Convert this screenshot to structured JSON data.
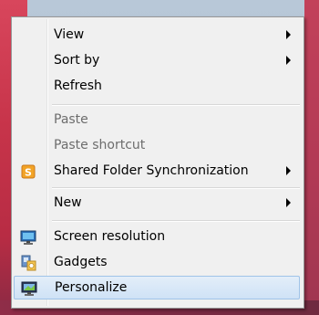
{
  "context_menu": {
    "items": [
      {
        "label": "View",
        "submenu": true,
        "enabled": true
      },
      {
        "label": "Sort by",
        "submenu": true,
        "enabled": true
      },
      {
        "label": "Refresh",
        "submenu": false,
        "enabled": true
      },
      {
        "label": "Paste",
        "submenu": false,
        "enabled": false
      },
      {
        "label": "Paste shortcut",
        "submenu": false,
        "enabled": false
      },
      {
        "label": "Shared Folder Synchronization",
        "submenu": true,
        "enabled": true,
        "icon": "shared-folder-sync-icon"
      },
      {
        "label": "New",
        "submenu": true,
        "enabled": true
      },
      {
        "label": "Screen resolution",
        "submenu": false,
        "enabled": true,
        "icon": "screen-resolution-icon"
      },
      {
        "label": "Gadgets",
        "submenu": false,
        "enabled": true,
        "icon": "gadgets-icon"
      },
      {
        "label": "Personalize",
        "submenu": false,
        "enabled": true,
        "selected": true,
        "icon": "personalize-icon"
      }
    ]
  },
  "colors": {
    "menu_bg": "#f0f0f0",
    "selected_bg": "#cfe2f6",
    "disabled_text": "#6d6d6d",
    "desktop_accent": "#c7344a"
  }
}
